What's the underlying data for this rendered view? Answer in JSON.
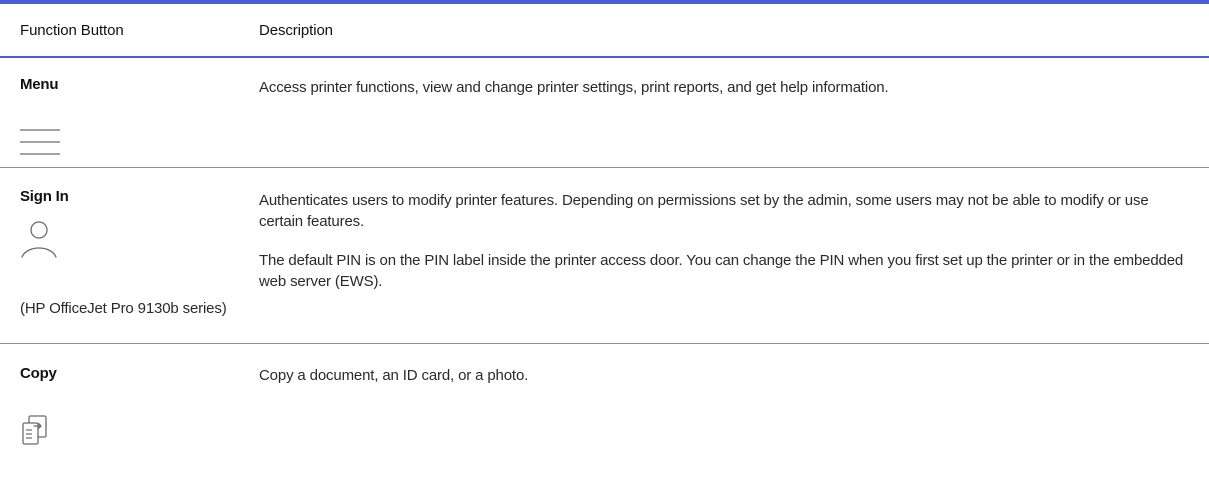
{
  "table": {
    "headers": {
      "function_button": "Function Button",
      "description": "Description"
    },
    "rows": [
      {
        "name": "Menu",
        "icon": "menu-icon",
        "description": [
          "Access printer functions, view and change printer settings, print reports, and get help information."
        ],
        "note": ""
      },
      {
        "name": "Sign In",
        "icon": "user-icon",
        "description": [
          "Authenticates users to modify printer features. Depending on permissions set by the admin, some users may not be able to modify or use certain features.",
          "The default PIN is on the PIN label inside the printer access door. You can change the PIN when you first set up the printer or in the embedded web server (EWS)."
        ],
        "note": "(HP OfficeJet Pro 9130b series)"
      },
      {
        "name": "Copy",
        "icon": "copy-icon",
        "description": [
          "Copy a document, an ID card, or a photo."
        ],
        "note": ""
      }
    ]
  },
  "colors": {
    "rule": "#4a5dd9",
    "row_divider": "#7b8ce0"
  }
}
